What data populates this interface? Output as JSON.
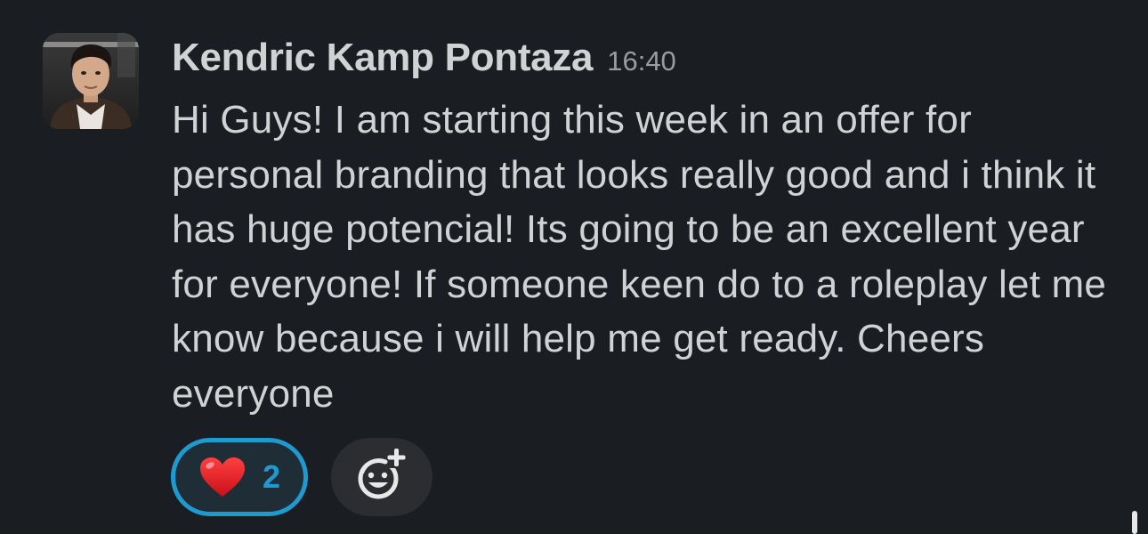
{
  "message": {
    "author": "Kendric Kamp Pontaza",
    "timestamp": "16:40",
    "text": "Hi Guys! I am starting this week in an offer for personal branding that looks really good and i think it has huge potencial! Its going to be an excellent year for everyone! If someone keen do to a roleplay let me know because i will help me get ready. Cheers everyone",
    "avatar_icon": "user-avatar-photo"
  },
  "reactions": [
    {
      "emoji": "heart",
      "count": "2",
      "selected": true
    }
  ],
  "add_reaction_icon": "add-emoji-icon",
  "colors": {
    "background": "#1a1d21",
    "text": "#d1d2d3",
    "muted": "#9b9c9e",
    "accent": "#1d9bd1",
    "heart": "#e01e1e"
  }
}
